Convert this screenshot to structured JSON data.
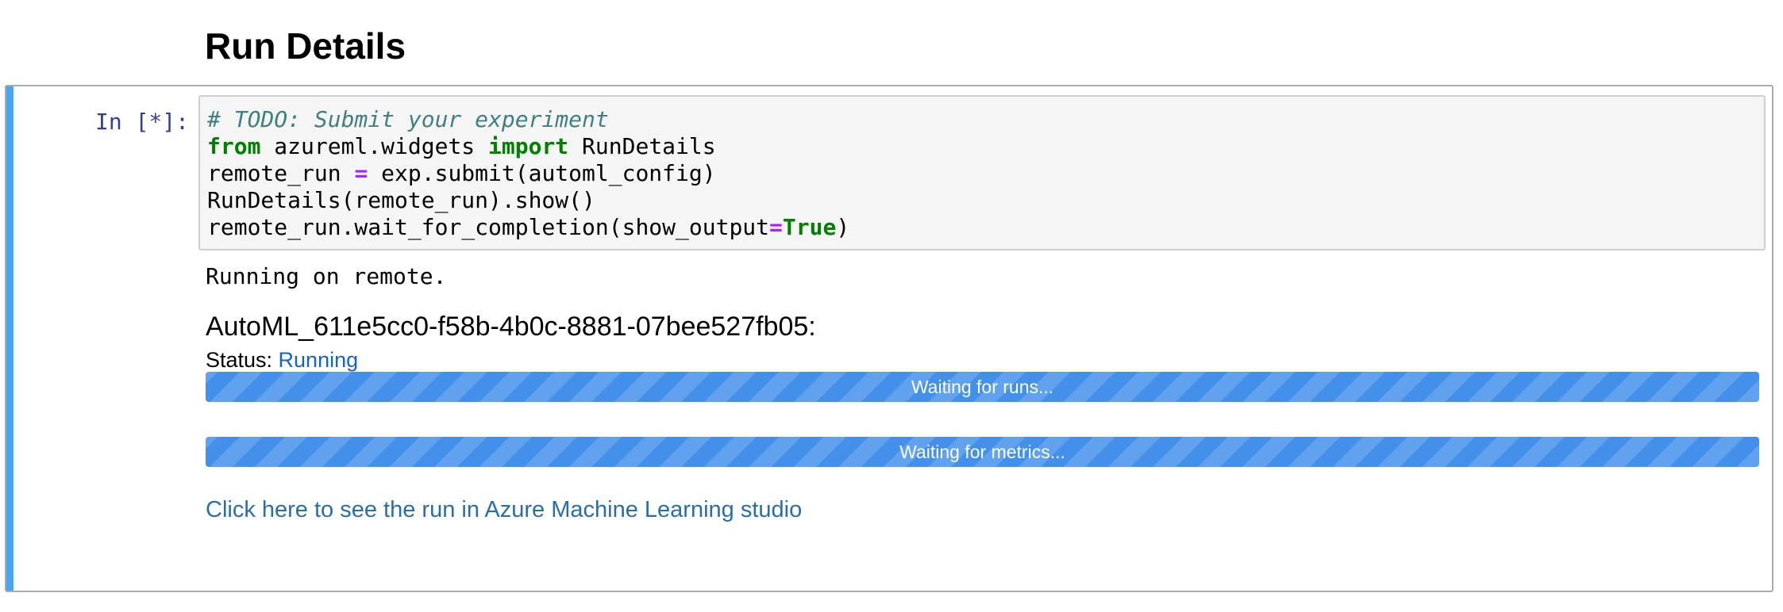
{
  "notebook": {
    "heading": "Run Details",
    "cell": {
      "prompt": "In [*]:",
      "code_lines": [
        [
          {
            "text": "# TODO: Submit your experiment",
            "kind": "comment"
          }
        ],
        [
          {
            "text": "from",
            "kind": "keyword"
          },
          {
            "text": " azureml.widgets ",
            "kind": "plain"
          },
          {
            "text": "import",
            "kind": "keyword"
          },
          {
            "text": " RunDetails",
            "kind": "plain"
          }
        ],
        [
          {
            "text": "remote_run ",
            "kind": "plain"
          },
          {
            "text": "=",
            "kind": "operator"
          },
          {
            "text": " exp.submit(automl_config)",
            "kind": "plain"
          }
        ],
        [
          {
            "text": "RunDetails(remote_run).show()",
            "kind": "plain"
          }
        ],
        [
          {
            "text": "remote_run.wait_for_completion(show_output",
            "kind": "plain"
          },
          {
            "text": "=",
            "kind": "operator"
          },
          {
            "text": "True",
            "kind": "keyword"
          },
          {
            "text": ")",
            "kind": "plain"
          }
        ]
      ],
      "output": {
        "stdout": "Running on remote.",
        "run_id": "AutoML_611e5cc0-f58b-4b0c-8881-07bee527fb05:",
        "status_label": "Status: ",
        "status_value": "Running",
        "runs_progress": {
          "label": "Waiting for runs...",
          "fraction": 1.0
        },
        "metrics_progress": {
          "label": "Waiting for metrics...",
          "fraction": 1.0
        },
        "studio_link": "Click here to see the run in Azure Machine Learning studio"
      }
    }
  },
  "colors": {
    "cell_selected_bar": "#42a5f5",
    "prompt": "#303f9f",
    "comment": "#408080",
    "keyword": "#008000",
    "operator": "#aa22ff",
    "status_running": "#1565c0",
    "progress_bar": "#4290ea",
    "link": "#296eaa"
  }
}
